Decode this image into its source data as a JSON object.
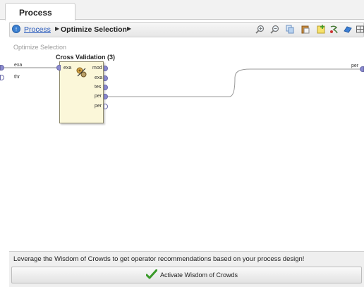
{
  "tab": {
    "label": "Process"
  },
  "breadcrumb": {
    "root": "Process",
    "current": "Optimize Selection"
  },
  "toolbar": {
    "icons": [
      "zoom-in-icon",
      "zoom-out-icon",
      "copy-icon",
      "paste-icon",
      "add-note-icon",
      "auto-wire-icon",
      "save-icon",
      "arrange-grid-icon"
    ]
  },
  "canvas": {
    "subprocess_label": "Optimize Selection",
    "left_ports": [
      "exa",
      "thr"
    ],
    "right_port": "per"
  },
  "operator": {
    "title": "Cross Validation (3)",
    "input_ports": [
      "exa"
    ],
    "output_ports": [
      "mod",
      "exa",
      "tes",
      "per",
      "per"
    ]
  },
  "wisdom": {
    "message": "Leverage the Wisdom of Crowds to get operator recommendations based on your process design!",
    "button_label": "Activate Wisdom of Crowds"
  },
  "colors": {
    "port": "#8a8ad0",
    "operator_bg": "#fbf7d9",
    "link": "#2255bb",
    "check": "#3a9a2a"
  }
}
